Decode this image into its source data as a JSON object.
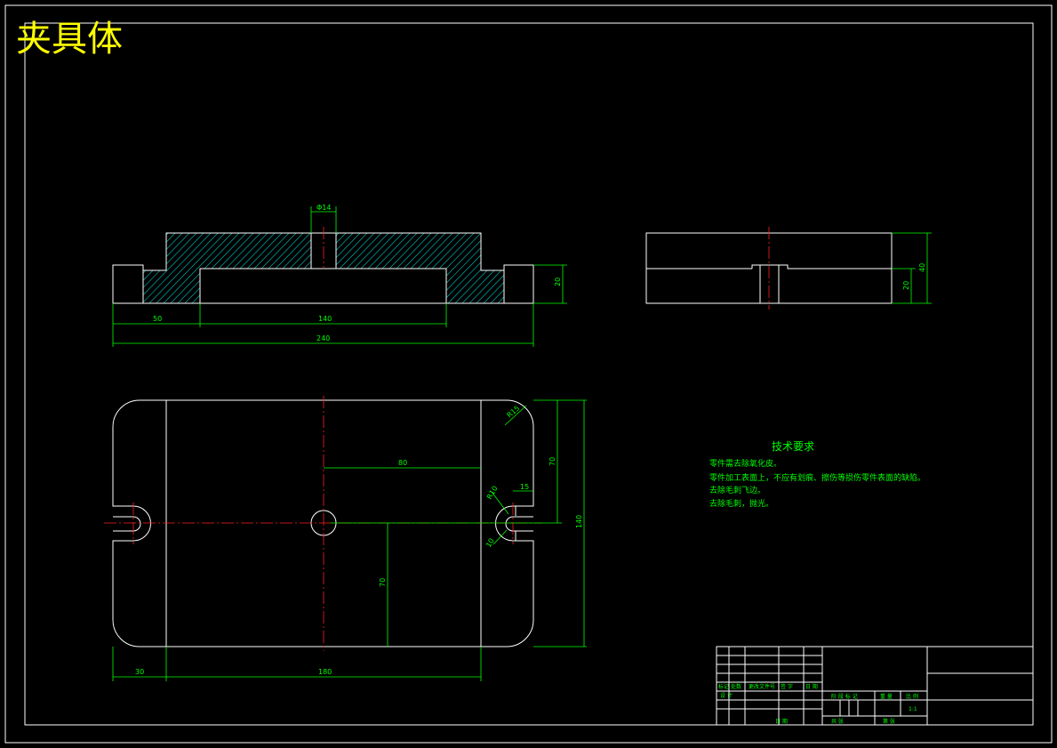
{
  "drawing": {
    "title": "夹具体",
    "scale": "1:1",
    "colors": {
      "outline": "#ffffff",
      "dimension": "#00ff00",
      "centerline": "#ff2020",
      "title": "#ffff00",
      "hatch": "#00c8c8"
    }
  },
  "front_view": {
    "dim_bore": "Φ14",
    "dim_left": "50",
    "dim_mid": "140",
    "dim_total": "240",
    "dim_height": "20"
  },
  "side_view": {
    "dim_total": "40",
    "dim_step": "20"
  },
  "top_view": {
    "dim_r": "R15",
    "dim_80": "80",
    "dim_70a": "70",
    "dim_140": "140",
    "dim_r10": "R10",
    "dim_15": "15",
    "dim_10": "10",
    "dim_70b": "70",
    "dim_30": "30",
    "dim_180": "180"
  },
  "tech_requirements": {
    "heading": "技术要求",
    "items": [
      "零件需去除氧化皮。",
      "零件加工表面上，不应有划痕、擦伤等损伤零件表面的缺陷。",
      "去除毛刺飞边。",
      "去除毛刺，抛光。"
    ]
  },
  "title_block": {
    "labels": [
      "标记",
      "处数",
      "更改文件号",
      "签 字",
      "日 期"
    ],
    "design": "设 计",
    "stage": "阶 段 标 记",
    "weight": "重 量",
    "ratio": "比 例",
    "approve": "日 期",
    "sheets": "共 张",
    "sheet": "第 张"
  }
}
